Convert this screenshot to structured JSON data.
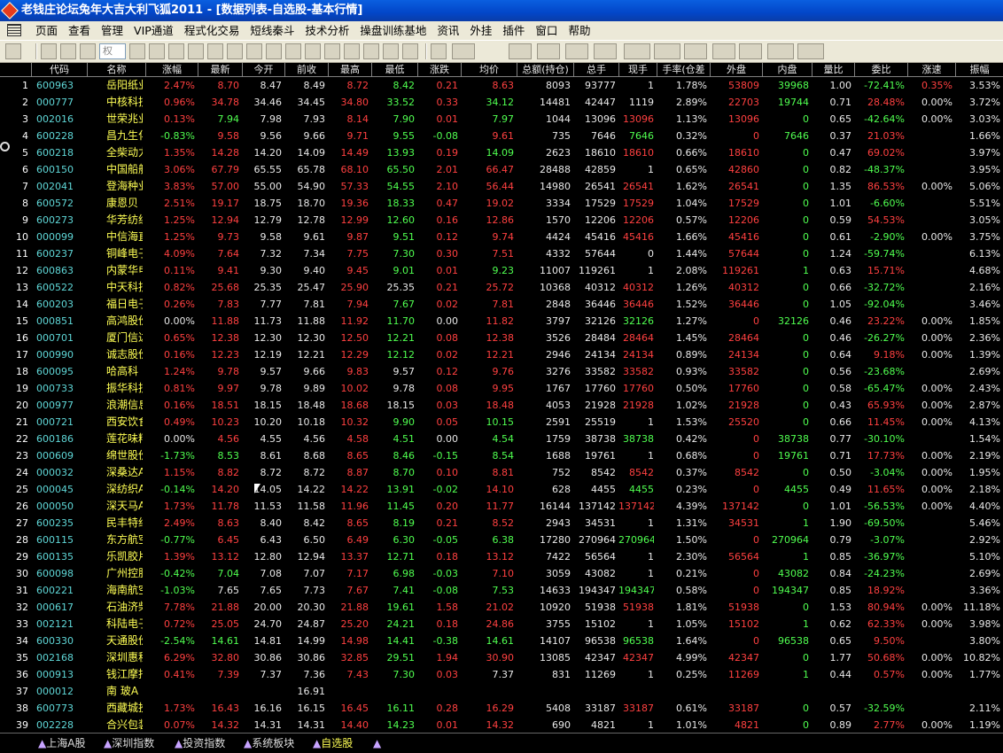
{
  "window": {
    "title": "老钱庄论坛兔年大吉大利飞狐2011 - [数据列表-自选股-基本行情]"
  },
  "menu": [
    "页面",
    "查看",
    "管理",
    "VIP通道",
    "程式化交易",
    "短线秦斗",
    "技术分析",
    "操盘训练基地",
    "资讯",
    "外挂",
    "插件",
    "窗口",
    "帮助"
  ],
  "toolbar": {
    "combo_value": "权"
  },
  "colors": {
    "up": "#ff4040",
    "down": "#50ff50",
    "flat": "#e8e8e8",
    "name": "#ffff55",
    "code": "#5fd7d7"
  },
  "columns": [
    "代码",
    "名称",
    "涨幅",
    "最新",
    "今开",
    "前收",
    "最高",
    "最低",
    "涨跌",
    "均价",
    "总额(持仓)",
    "总手",
    "现手",
    "手率(仓差",
    "外盘",
    "内盘",
    "量比",
    "委比",
    "涨速",
    "振幅"
  ],
  "rows": [
    [
      "1",
      "600963",
      "岳阳纸业",
      "2.47%",
      "8.70",
      "8.47",
      "8.49",
      "8.72",
      "8.42",
      "0.21",
      "8.63",
      "8093",
      "93777",
      "1",
      "1.78%",
      "53809",
      "39968",
      "1.00",
      "-72.41%",
      "0.35%",
      "3.53%"
    ],
    [
      "2",
      "000777",
      "中核科技",
      "0.96%",
      "34.78",
      "34.46",
      "34.45",
      "34.80",
      "33.52",
      "0.33",
      "34.12",
      "14481",
      "42447",
      "1119",
      "2.89%",
      "22703",
      "19744",
      "0.71",
      "28.48%",
      "0.00%",
      "3.72%"
    ],
    [
      "3",
      "002016",
      "世荣兆业",
      "0.13%",
      "7.94",
      "7.98",
      "7.93",
      "8.14",
      "7.90",
      "0.01",
      "7.97",
      "1044",
      "13096",
      "13096",
      "1.13%",
      "13096",
      "0",
      "0.65",
      "-42.64%",
      "0.00%",
      "3.03%"
    ],
    [
      "4",
      "600228",
      "昌九生化",
      "-0.83%",
      "9.58",
      "9.56",
      "9.66",
      "9.71",
      "9.55",
      "-0.08",
      "9.61",
      "735",
      "7646",
      "7646",
      "0.32%",
      "0",
      "7646",
      "0.37",
      "21.03%",
      "",
      "1.66%"
    ],
    [
      "5",
      "600218",
      "全柴动力",
      "1.35%",
      "14.28",
      "14.20",
      "14.09",
      "14.49",
      "13.93",
      "0.19",
      "14.09",
      "2623",
      "18610",
      "18610",
      "0.66%",
      "18610",
      "0",
      "0.47",
      "69.02%",
      "",
      "3.97%"
    ],
    [
      "6",
      "600150",
      "中国船舶",
      "3.06%",
      "67.79",
      "65.55",
      "65.78",
      "68.10",
      "65.50",
      "2.01",
      "66.47",
      "28488",
      "42859",
      "1",
      "0.65%",
      "42860",
      "0",
      "0.82",
      "-48.37%",
      "",
      "3.95%"
    ],
    [
      "7",
      "002041",
      "登海种业",
      "3.83%",
      "57.00",
      "55.00",
      "54.90",
      "57.33",
      "54.55",
      "2.10",
      "56.44",
      "14980",
      "26541",
      "26541",
      "1.62%",
      "26541",
      "0",
      "1.35",
      "86.53%",
      "0.00%",
      "5.06%"
    ],
    [
      "8",
      "600572",
      "康恩贝",
      "2.51%",
      "19.17",
      "18.75",
      "18.70",
      "19.36",
      "18.33",
      "0.47",
      "19.02",
      "3334",
      "17529",
      "17529",
      "1.04%",
      "17529",
      "0",
      "1.01",
      "-6.60%",
      "",
      "5.51%"
    ],
    [
      "9",
      "600273",
      "华芳纺织",
      "1.25%",
      "12.94",
      "12.79",
      "12.78",
      "12.99",
      "12.60",
      "0.16",
      "12.86",
      "1570",
      "12206",
      "12206",
      "0.57%",
      "12206",
      "0",
      "0.59",
      "54.53%",
      "",
      "3.05%"
    ],
    [
      "10",
      "000099",
      "中信海直",
      "1.25%",
      "9.73",
      "9.58",
      "9.61",
      "9.87",
      "9.51",
      "0.12",
      "9.74",
      "4424",
      "45416",
      "45416",
      "1.66%",
      "45416",
      "0",
      "0.61",
      "-2.90%",
      "0.00%",
      "3.75%"
    ],
    [
      "11",
      "600237",
      "铜峰电子",
      "4.09%",
      "7.64",
      "7.32",
      "7.34",
      "7.75",
      "7.30",
      "0.30",
      "7.51",
      "4332",
      "57644",
      "0",
      "1.44%",
      "57644",
      "0",
      "1.24",
      "-59.74%",
      "",
      "6.13%"
    ],
    [
      "12",
      "600863",
      "内蒙华电",
      "0.11%",
      "9.41",
      "9.30",
      "9.40",
      "9.45",
      "9.01",
      "0.01",
      "9.23",
      "11007",
      "119261",
      "1",
      "2.08%",
      "119261",
      "1",
      "0.63",
      "15.71%",
      "",
      "4.68%"
    ],
    [
      "13",
      "600522",
      "中天科技",
      "0.82%",
      "25.68",
      "25.35",
      "25.47",
      "25.90",
      "25.35",
      "0.21",
      "25.72",
      "10368",
      "40312",
      "40312",
      "1.26%",
      "40312",
      "0",
      "0.66",
      "-32.72%",
      "",
      "2.16%"
    ],
    [
      "14",
      "600203",
      "福日电子",
      "0.26%",
      "7.83",
      "7.77",
      "7.81",
      "7.94",
      "7.67",
      "0.02",
      "7.81",
      "2848",
      "36446",
      "36446",
      "1.52%",
      "36446",
      "0",
      "1.05",
      "-92.04%",
      "",
      "3.46%"
    ],
    [
      "15",
      "000851",
      "高鸿股份",
      "0.00%",
      "11.88",
      "11.73",
      "11.88",
      "11.92",
      "11.70",
      "0.00",
      "11.82",
      "3797",
      "32126",
      "32126",
      "1.27%",
      "0",
      "32126",
      "0.46",
      "23.22%",
      "0.00%",
      "1.85%"
    ],
    [
      "16",
      "000701",
      "厦门信达",
      "0.65%",
      "12.38",
      "12.30",
      "12.30",
      "12.50",
      "12.21",
      "0.08",
      "12.38",
      "3526",
      "28484",
      "28464",
      "1.45%",
      "28464",
      "0",
      "0.46",
      "-26.27%",
      "0.00%",
      "2.36%"
    ],
    [
      "17",
      "000990",
      "诚志股份",
      "0.16%",
      "12.23",
      "12.19",
      "12.21",
      "12.29",
      "12.12",
      "0.02",
      "12.21",
      "2946",
      "24134",
      "24134",
      "0.89%",
      "24134",
      "0",
      "0.64",
      "9.18%",
      "0.00%",
      "1.39%"
    ],
    [
      "18",
      "600095",
      "哈高科",
      "1.24%",
      "9.78",
      "9.57",
      "9.66",
      "9.83",
      "9.57",
      "0.12",
      "9.76",
      "3276",
      "33582",
      "33582",
      "0.93%",
      "33582",
      "0",
      "0.56",
      "-23.68%",
      "",
      "2.69%"
    ],
    [
      "19",
      "000733",
      "振华科技",
      "0.81%",
      "9.97",
      "9.78",
      "9.89",
      "10.02",
      "9.78",
      "0.08",
      "9.95",
      "1767",
      "17760",
      "17760",
      "0.50%",
      "17760",
      "0",
      "0.58",
      "-65.47%",
      "0.00%",
      "2.43%"
    ],
    [
      "20",
      "000977",
      "浪潮信息",
      "0.16%",
      "18.51",
      "18.15",
      "18.48",
      "18.68",
      "18.15",
      "0.03",
      "18.48",
      "4053",
      "21928",
      "21928",
      "1.02%",
      "21928",
      "0",
      "0.43",
      "65.93%",
      "0.00%",
      "2.87%"
    ],
    [
      "21",
      "000721",
      "西安饮食",
      "0.49%",
      "10.23",
      "10.20",
      "10.18",
      "10.32",
      "9.90",
      "0.05",
      "10.15",
      "2591",
      "25519",
      "1",
      "1.53%",
      "25520",
      "0",
      "0.66",
      "11.45%",
      "0.00%",
      "4.13%"
    ],
    [
      "22",
      "600186",
      "莲花味精",
      "0.00%",
      "4.56",
      "4.55",
      "4.56",
      "4.58",
      "4.51",
      "0.00",
      "4.54",
      "1759",
      "38738",
      "38738",
      "0.42%",
      "0",
      "38738",
      "0.77",
      "-30.10%",
      "",
      "1.54%"
    ],
    [
      "23",
      "000609",
      "绵世股份",
      "-1.73%",
      "8.53",
      "8.61",
      "8.68",
      "8.65",
      "8.46",
      "-0.15",
      "8.54",
      "1688",
      "19761",
      "1",
      "0.68%",
      "0",
      "19761",
      "0.71",
      "17.73%",
      "0.00%",
      "2.19%"
    ],
    [
      "24",
      "000032",
      "深桑达A",
      "1.15%",
      "8.82",
      "8.72",
      "8.72",
      "8.87",
      "8.70",
      "0.10",
      "8.81",
      "752",
      "8542",
      "8542",
      "0.37%",
      "8542",
      "0",
      "0.50",
      "-3.04%",
      "0.00%",
      "1.95%"
    ],
    [
      "25",
      "000045",
      "深纺织A",
      "-0.14%",
      "14.20",
      "14.05",
      "14.22",
      "14.22",
      "13.91",
      "-0.02",
      "14.10",
      "628",
      "4455",
      "4455",
      "0.23%",
      "0",
      "4455",
      "0.49",
      "11.65%",
      "0.00%",
      "2.18%"
    ],
    [
      "26",
      "000050",
      "深天马A",
      "1.73%",
      "11.78",
      "11.53",
      "11.58",
      "11.96",
      "11.45",
      "0.20",
      "11.77",
      "16144",
      "137142",
      "137142",
      "4.39%",
      "137142",
      "0",
      "1.01",
      "-56.53%",
      "0.00%",
      "4.40%"
    ],
    [
      "27",
      "600235",
      "民丰特纸",
      "2.49%",
      "8.63",
      "8.40",
      "8.42",
      "8.65",
      "8.19",
      "0.21",
      "8.52",
      "2943",
      "34531",
      "1",
      "1.31%",
      "34531",
      "1",
      "1.90",
      "-69.50%",
      "",
      "5.46%"
    ],
    [
      "28",
      "600115",
      "东方航空",
      "-0.77%",
      "6.45",
      "6.43",
      "6.50",
      "6.49",
      "6.30",
      "-0.05",
      "6.38",
      "17280",
      "270964",
      "270964",
      "1.50%",
      "0",
      "270964",
      "0.79",
      "-3.07%",
      "",
      "2.92%"
    ],
    [
      "29",
      "600135",
      "乐凯胶片",
      "1.39%",
      "13.12",
      "12.80",
      "12.94",
      "13.37",
      "12.71",
      "0.18",
      "13.12",
      "7422",
      "56564",
      "1",
      "2.30%",
      "56564",
      "1",
      "0.85",
      "-36.97%",
      "",
      "5.10%"
    ],
    [
      "30",
      "600098",
      "广州控股",
      "-0.42%",
      "7.04",
      "7.08",
      "7.07",
      "7.17",
      "6.98",
      "-0.03",
      "7.10",
      "3059",
      "43082",
      "1",
      "0.21%",
      "0",
      "43082",
      "0.84",
      "-24.23%",
      "",
      "2.69%"
    ],
    [
      "31",
      "600221",
      "海南航空",
      "-1.03%",
      "7.65",
      "7.65",
      "7.73",
      "7.67",
      "7.41",
      "-0.08",
      "7.53",
      "14633",
      "194347",
      "194347",
      "0.58%",
      "0",
      "194347",
      "0.85",
      "18.92%",
      "",
      "3.36%"
    ],
    [
      "32",
      "000617",
      "石油济柴",
      "7.78%",
      "21.88",
      "20.00",
      "20.30",
      "21.88",
      "19.61",
      "1.58",
      "21.02",
      "10920",
      "51938",
      "51938",
      "1.81%",
      "51938",
      "0",
      "1.53",
      "80.94%",
      "0.00%",
      "11.18%"
    ],
    [
      "33",
      "002121",
      "科陆电子",
      "0.72%",
      "25.05",
      "24.70",
      "24.87",
      "25.20",
      "24.21",
      "0.18",
      "24.86",
      "3755",
      "15102",
      "1",
      "1.05%",
      "15102",
      "1",
      "0.62",
      "62.33%",
      "0.00%",
      "3.98%"
    ],
    [
      "34",
      "600330",
      "天通股份",
      "-2.54%",
      "14.61",
      "14.81",
      "14.99",
      "14.98",
      "14.41",
      "-0.38",
      "14.61",
      "14107",
      "96538",
      "96538",
      "1.64%",
      "0",
      "96538",
      "0.65",
      "9.50%",
      "",
      "3.80%"
    ],
    [
      "35",
      "002168",
      "深圳惠程",
      "6.29%",
      "32.80",
      "30.86",
      "30.86",
      "32.85",
      "29.51",
      "1.94",
      "30.90",
      "13085",
      "42347",
      "42347",
      "4.99%",
      "42347",
      "0",
      "1.77",
      "50.68%",
      "0.00%",
      "10.82%"
    ],
    [
      "36",
      "000913",
      "钱江摩托",
      "0.41%",
      "7.39",
      "7.37",
      "7.36",
      "7.43",
      "7.30",
      "0.03",
      "7.37",
      "831",
      "11269",
      "1",
      "0.25%",
      "11269",
      "1",
      "0.44",
      "0.57%",
      "0.00%",
      "1.77%"
    ],
    [
      "37",
      "000012",
      "南 玻A",
      "",
      "",
      "",
      "16.91",
      "",
      "",
      "",
      "",
      "",
      "",
      "",
      "",
      "",
      "",
      "",
      "",
      "",
      ""
    ],
    [
      "38",
      "600773",
      "西藏城投",
      "1.73%",
      "16.43",
      "16.16",
      "16.15",
      "16.45",
      "16.11",
      "0.28",
      "16.29",
      "5408",
      "33187",
      "33187",
      "0.61%",
      "33187",
      "0",
      "0.57",
      "-32.59%",
      "",
      "2.11%"
    ],
    [
      "39",
      "002228",
      "合兴包装",
      "0.07%",
      "14.32",
      "14.31",
      "14.31",
      "14.40",
      "14.23",
      "0.01",
      "14.32",
      "690",
      "4821",
      "1",
      "1.01%",
      "4821",
      "0",
      "0.89",
      "2.77%",
      "0.00%",
      "1.19%"
    ]
  ],
  "tabs": [
    "上海A股",
    "深圳指数",
    "投资指数",
    "系统板块",
    "自选股",
    ""
  ],
  "active_tab": 4
}
